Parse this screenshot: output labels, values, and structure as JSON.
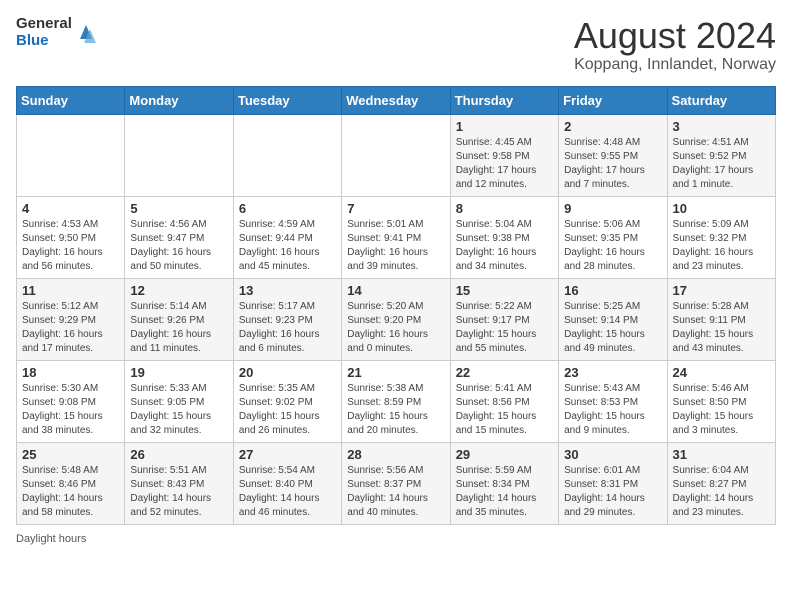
{
  "header": {
    "logo_general": "General",
    "logo_blue": "Blue",
    "title": "August 2024",
    "subtitle": "Koppang, Innlandet, Norway"
  },
  "weekdays": [
    "Sunday",
    "Monday",
    "Tuesday",
    "Wednesday",
    "Thursday",
    "Friday",
    "Saturday"
  ],
  "weeks": [
    [
      {
        "day": "",
        "info": ""
      },
      {
        "day": "",
        "info": ""
      },
      {
        "day": "",
        "info": ""
      },
      {
        "day": "",
        "info": ""
      },
      {
        "day": "1",
        "info": "Sunrise: 4:45 AM\nSunset: 9:58 PM\nDaylight: 17 hours\nand 12 minutes."
      },
      {
        "day": "2",
        "info": "Sunrise: 4:48 AM\nSunset: 9:55 PM\nDaylight: 17 hours\nand 7 minutes."
      },
      {
        "day": "3",
        "info": "Sunrise: 4:51 AM\nSunset: 9:52 PM\nDaylight: 17 hours\nand 1 minute."
      }
    ],
    [
      {
        "day": "4",
        "info": "Sunrise: 4:53 AM\nSunset: 9:50 PM\nDaylight: 16 hours\nand 56 minutes."
      },
      {
        "day": "5",
        "info": "Sunrise: 4:56 AM\nSunset: 9:47 PM\nDaylight: 16 hours\nand 50 minutes."
      },
      {
        "day": "6",
        "info": "Sunrise: 4:59 AM\nSunset: 9:44 PM\nDaylight: 16 hours\nand 45 minutes."
      },
      {
        "day": "7",
        "info": "Sunrise: 5:01 AM\nSunset: 9:41 PM\nDaylight: 16 hours\nand 39 minutes."
      },
      {
        "day": "8",
        "info": "Sunrise: 5:04 AM\nSunset: 9:38 PM\nDaylight: 16 hours\nand 34 minutes."
      },
      {
        "day": "9",
        "info": "Sunrise: 5:06 AM\nSunset: 9:35 PM\nDaylight: 16 hours\nand 28 minutes."
      },
      {
        "day": "10",
        "info": "Sunrise: 5:09 AM\nSunset: 9:32 PM\nDaylight: 16 hours\nand 23 minutes."
      }
    ],
    [
      {
        "day": "11",
        "info": "Sunrise: 5:12 AM\nSunset: 9:29 PM\nDaylight: 16 hours\nand 17 minutes."
      },
      {
        "day": "12",
        "info": "Sunrise: 5:14 AM\nSunset: 9:26 PM\nDaylight: 16 hours\nand 11 minutes."
      },
      {
        "day": "13",
        "info": "Sunrise: 5:17 AM\nSunset: 9:23 PM\nDaylight: 16 hours\nand 6 minutes."
      },
      {
        "day": "14",
        "info": "Sunrise: 5:20 AM\nSunset: 9:20 PM\nDaylight: 16 hours\nand 0 minutes."
      },
      {
        "day": "15",
        "info": "Sunrise: 5:22 AM\nSunset: 9:17 PM\nDaylight: 15 hours\nand 55 minutes."
      },
      {
        "day": "16",
        "info": "Sunrise: 5:25 AM\nSunset: 9:14 PM\nDaylight: 15 hours\nand 49 minutes."
      },
      {
        "day": "17",
        "info": "Sunrise: 5:28 AM\nSunset: 9:11 PM\nDaylight: 15 hours\nand 43 minutes."
      }
    ],
    [
      {
        "day": "18",
        "info": "Sunrise: 5:30 AM\nSunset: 9:08 PM\nDaylight: 15 hours\nand 38 minutes."
      },
      {
        "day": "19",
        "info": "Sunrise: 5:33 AM\nSunset: 9:05 PM\nDaylight: 15 hours\nand 32 minutes."
      },
      {
        "day": "20",
        "info": "Sunrise: 5:35 AM\nSunset: 9:02 PM\nDaylight: 15 hours\nand 26 minutes."
      },
      {
        "day": "21",
        "info": "Sunrise: 5:38 AM\nSunset: 8:59 PM\nDaylight: 15 hours\nand 20 minutes."
      },
      {
        "day": "22",
        "info": "Sunrise: 5:41 AM\nSunset: 8:56 PM\nDaylight: 15 hours\nand 15 minutes."
      },
      {
        "day": "23",
        "info": "Sunrise: 5:43 AM\nSunset: 8:53 PM\nDaylight: 15 hours\nand 9 minutes."
      },
      {
        "day": "24",
        "info": "Sunrise: 5:46 AM\nSunset: 8:50 PM\nDaylight: 15 hours\nand 3 minutes."
      }
    ],
    [
      {
        "day": "25",
        "info": "Sunrise: 5:48 AM\nSunset: 8:46 PM\nDaylight: 14 hours\nand 58 minutes."
      },
      {
        "day": "26",
        "info": "Sunrise: 5:51 AM\nSunset: 8:43 PM\nDaylight: 14 hours\nand 52 minutes."
      },
      {
        "day": "27",
        "info": "Sunrise: 5:54 AM\nSunset: 8:40 PM\nDaylight: 14 hours\nand 46 minutes."
      },
      {
        "day": "28",
        "info": "Sunrise: 5:56 AM\nSunset: 8:37 PM\nDaylight: 14 hours\nand 40 minutes."
      },
      {
        "day": "29",
        "info": "Sunrise: 5:59 AM\nSunset: 8:34 PM\nDaylight: 14 hours\nand 35 minutes."
      },
      {
        "day": "30",
        "info": "Sunrise: 6:01 AM\nSunset: 8:31 PM\nDaylight: 14 hours\nand 29 minutes."
      },
      {
        "day": "31",
        "info": "Sunrise: 6:04 AM\nSunset: 8:27 PM\nDaylight: 14 hours\nand 23 minutes."
      }
    ]
  ],
  "footer": {
    "daylight_label": "Daylight hours"
  }
}
